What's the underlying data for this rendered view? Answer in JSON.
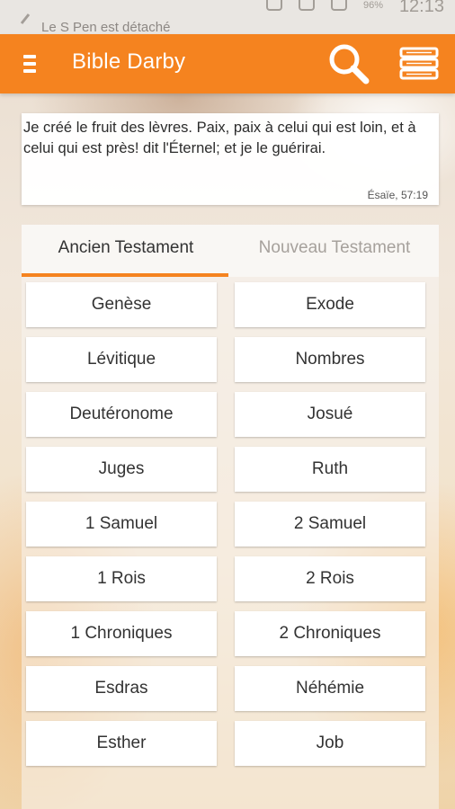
{
  "status_bar": {
    "notification_text": "Le S Pen est détaché",
    "battery": "96%",
    "time": "12:13"
  },
  "app_bar": {
    "title": "Bible Darby",
    "menu_icon": "menu-icon",
    "search_icon": "search-icon",
    "books_icon": "stacked-books-icon",
    "color": "#f5831f"
  },
  "verse": {
    "text": "Je créé le fruit des lèvres. Paix, paix à celui qui est loin, et à celui qui est près! dit l'Éternel; et je le guérirai.",
    "reference": "Ésaïe, 57:19"
  },
  "tabs": [
    {
      "label": "Ancien Testament",
      "active": true
    },
    {
      "label": "Nouveau Testament",
      "active": false
    }
  ],
  "books": [
    "Genèse",
    "Exode",
    "Lévitique",
    "Nombres",
    "Deutéronome",
    "Josué",
    "Juges",
    "Ruth",
    "1 Samuel",
    "2 Samuel",
    "1 Rois",
    "2 Rois",
    "1 Chroniques",
    "2 Chroniques",
    "Esdras",
    "Néhémie",
    "Esther",
    "Job"
  ]
}
